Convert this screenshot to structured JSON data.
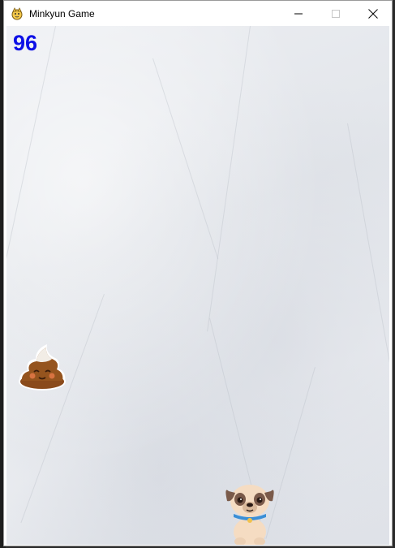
{
  "window": {
    "title": "Minkyun Game"
  },
  "controls": {
    "minimize": "minimize-icon",
    "maximize": "maximize-icon",
    "close": "close-icon"
  },
  "game": {
    "score": "96",
    "score_color": "#0d10e6",
    "sprites": [
      "poop-enemy",
      "pug-player"
    ]
  }
}
